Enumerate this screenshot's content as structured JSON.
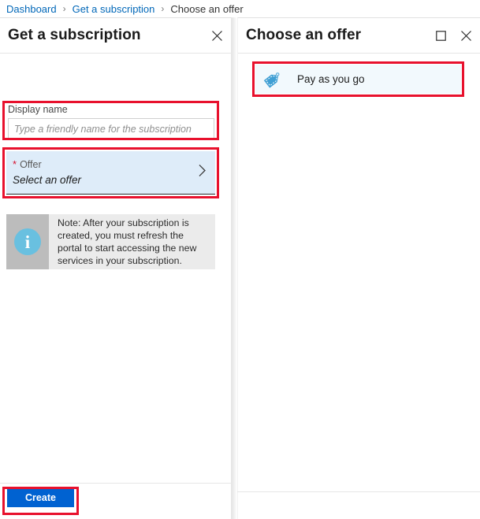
{
  "breadcrumb": {
    "items": [
      {
        "label": "Dashboard",
        "type": "link"
      },
      {
        "label": "Get a subscription",
        "type": "link"
      },
      {
        "label": "Choose an offer",
        "type": "current"
      }
    ],
    "separator": "›"
  },
  "left_blade": {
    "title": "Get a subscription",
    "close_icon": "close-icon",
    "display_name": {
      "label": "Display name",
      "value": "",
      "placeholder": "Type a friendly name for the subscription"
    },
    "offer": {
      "required_marker": "*",
      "label": "Offer",
      "value": "Select an offer",
      "chevron_icon": "chevron-right-icon"
    },
    "note": {
      "icon": "info-icon",
      "icon_glyph": "i",
      "text": "Note: After your subscription is created, you must refresh the portal to start accessing the new services in your subscription."
    },
    "footer": {
      "create_label": "Create"
    }
  },
  "right_blade": {
    "title": "Choose an offer",
    "maximize_icon": "maximize-icon",
    "close_icon": "close-icon",
    "offers": [
      {
        "label": "Pay as you go",
        "icon": "price-tag-icon"
      }
    ]
  },
  "colors": {
    "link_blue": "#0067b8",
    "primary_button": "#0062d1",
    "highlight_red": "#e8112d",
    "offer_row_bg": "#deecf9",
    "offer_item_bg": "#f2f9fd",
    "info_icon_blue": "#69c0e0",
    "note_icon_bg": "#bcbcbc",
    "note_text_bg": "#ebebeb",
    "tag_icon_blue": "#3f9fd4"
  }
}
